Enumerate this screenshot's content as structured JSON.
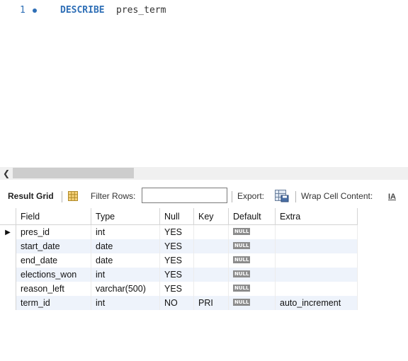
{
  "editor": {
    "line_number": "1",
    "keyword": "DESCRIBE",
    "identifier": "pres_term"
  },
  "toolbar": {
    "result_grid_label": "Result Grid",
    "filter_rows_label": "Filter Rows:",
    "filter_rows_value": "",
    "export_label": "Export:",
    "wrap_label": "Wrap Cell Content:",
    "wrap_icon_glyph": "IA"
  },
  "grid": {
    "columns": [
      "Field",
      "Type",
      "Null",
      "Key",
      "Default",
      "Extra"
    ],
    "null_badge": "NULL",
    "selected_row_marker": "▶",
    "rows": [
      {
        "field": "pres_id",
        "type": "int",
        "null": "YES",
        "key": "",
        "default": "NULL",
        "extra": ""
      },
      {
        "field": "start_date",
        "type": "date",
        "null": "YES",
        "key": "",
        "default": "NULL",
        "extra": ""
      },
      {
        "field": "end_date",
        "type": "date",
        "null": "YES",
        "key": "",
        "default": "NULL",
        "extra": ""
      },
      {
        "field": "elections_won",
        "type": "int",
        "null": "YES",
        "key": "",
        "default": "NULL",
        "extra": ""
      },
      {
        "field": "reason_left",
        "type": "varchar(500)",
        "null": "YES",
        "key": "",
        "default": "NULL",
        "extra": ""
      },
      {
        "field": "term_id",
        "type": "int",
        "null": "NO",
        "key": "PRI",
        "default": "NULL",
        "extra": "auto_increment"
      }
    ]
  },
  "colors": {
    "keyword": "#2f6fb6",
    "alt_row": "#eef3fb",
    "null_badge_bg": "#8c8c8c"
  },
  "icons": [
    "execution-dot-icon",
    "scroll-left-icon",
    "grid-layout-icon",
    "export-icon",
    "wrap-cell-icon",
    "row-pointer-icon"
  ]
}
